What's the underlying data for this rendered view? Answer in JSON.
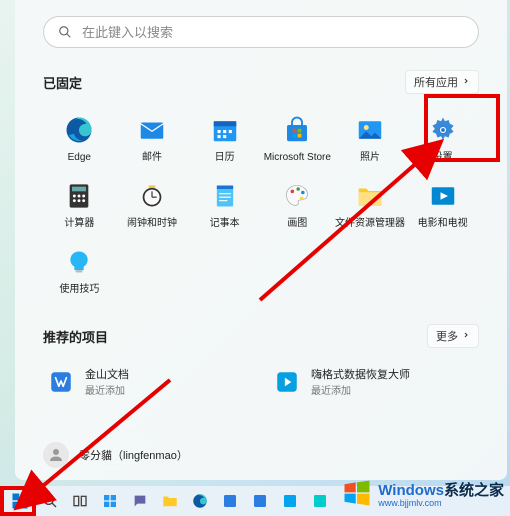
{
  "search": {
    "placeholder": "在此键入以搜索"
  },
  "pinned": {
    "title": "已固定",
    "all_apps_label": "所有应用",
    "apps": [
      {
        "label": "Edge",
        "icon": "edge"
      },
      {
        "label": "邮件",
        "icon": "mail"
      },
      {
        "label": "日历",
        "icon": "calendar"
      },
      {
        "label": "Microsoft Store",
        "icon": "store"
      },
      {
        "label": "照片",
        "icon": "photos"
      },
      {
        "label": "设置",
        "icon": "settings"
      },
      {
        "label": "计算器",
        "icon": "calculator"
      },
      {
        "label": "闹钟和时钟",
        "icon": "clock"
      },
      {
        "label": "记事本",
        "icon": "notepad"
      },
      {
        "label": "画图",
        "icon": "paint"
      },
      {
        "label": "文件资源管理器",
        "icon": "explorer"
      },
      {
        "label": "电影和电视",
        "icon": "movies"
      },
      {
        "label": "使用技巧",
        "icon": "tips"
      }
    ]
  },
  "recommended": {
    "title": "推荐的项目",
    "more_label": "更多",
    "items": [
      {
        "title": "金山文档",
        "sub": "最近添加",
        "icon": "wps"
      },
      {
        "title": "嗨格式数据恢复大师",
        "sub": "最近添加",
        "icon": "recovery"
      }
    ]
  },
  "user": {
    "name": "零分貓（lingfenmao）"
  },
  "watermark": {
    "main_en": "Windows",
    "main_zh": "系统之家",
    "sub": "www.bjjmlv.com"
  }
}
